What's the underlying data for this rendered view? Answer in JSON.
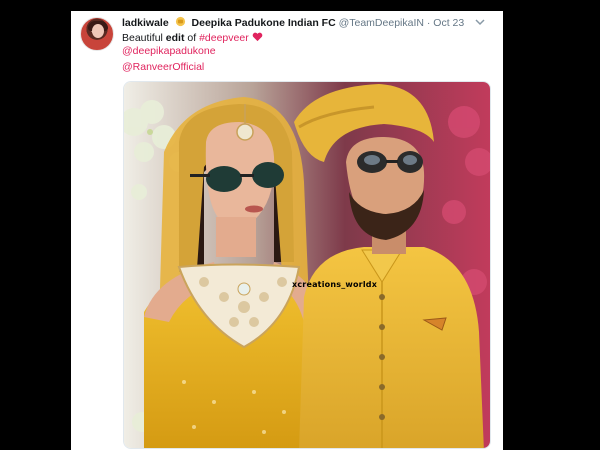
{
  "tweet": {
    "author_name": "ladkiwale",
    "retweeted_icon": "emoji-icon",
    "account_name": "Deepika Padukone Indian FC",
    "handle": "@TeamDeepikaIN",
    "separator": "·",
    "timestamp": "Oct 23",
    "text_plain": "Beautiful",
    "text_bold": "edit",
    "text_of": "of",
    "hashtag": "#deepveer",
    "emoji": "heart-icon",
    "mentions": [
      "@deepikapadukone",
      "@RanveerOfficial"
    ],
    "image_watermark": "xcreations_worldx"
  },
  "colors": {
    "link": "#e0245e",
    "text": "#14171a",
    "muted": "#657786",
    "background": "#000000"
  }
}
